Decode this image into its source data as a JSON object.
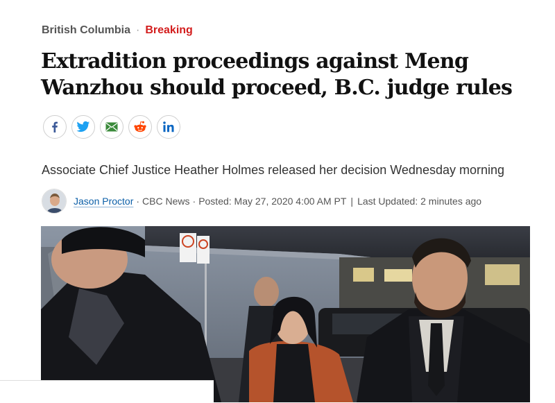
{
  "kicker": {
    "category": "British Columbia",
    "separator": "·",
    "label": "Breaking"
  },
  "headline": "Extradition proceedings against Meng Wanzhou should proceed, B.C. judge rules",
  "share": [
    {
      "icon": "facebook-icon",
      "color": "#3b5998"
    },
    {
      "icon": "twitter-icon",
      "color": "#1da1f2"
    },
    {
      "icon": "email-icon",
      "color": "#3a8a3a"
    },
    {
      "icon": "reddit-icon",
      "color": "#ff4500"
    },
    {
      "icon": "linkedin-icon",
      "color": "#0a66c2"
    }
  ],
  "deck": "Associate Chief Justice Heather Holmes released her decision Wednesday morning",
  "byline": {
    "author": "Jason Proctor",
    "source": "CBC News",
    "posted": "Posted: May 27, 2020 4:00 AM PT",
    "updated": "Last Updated: 2 minutes ago"
  },
  "colors": {
    "breaking": "#d31d1d",
    "link": "#0b5fa8"
  }
}
